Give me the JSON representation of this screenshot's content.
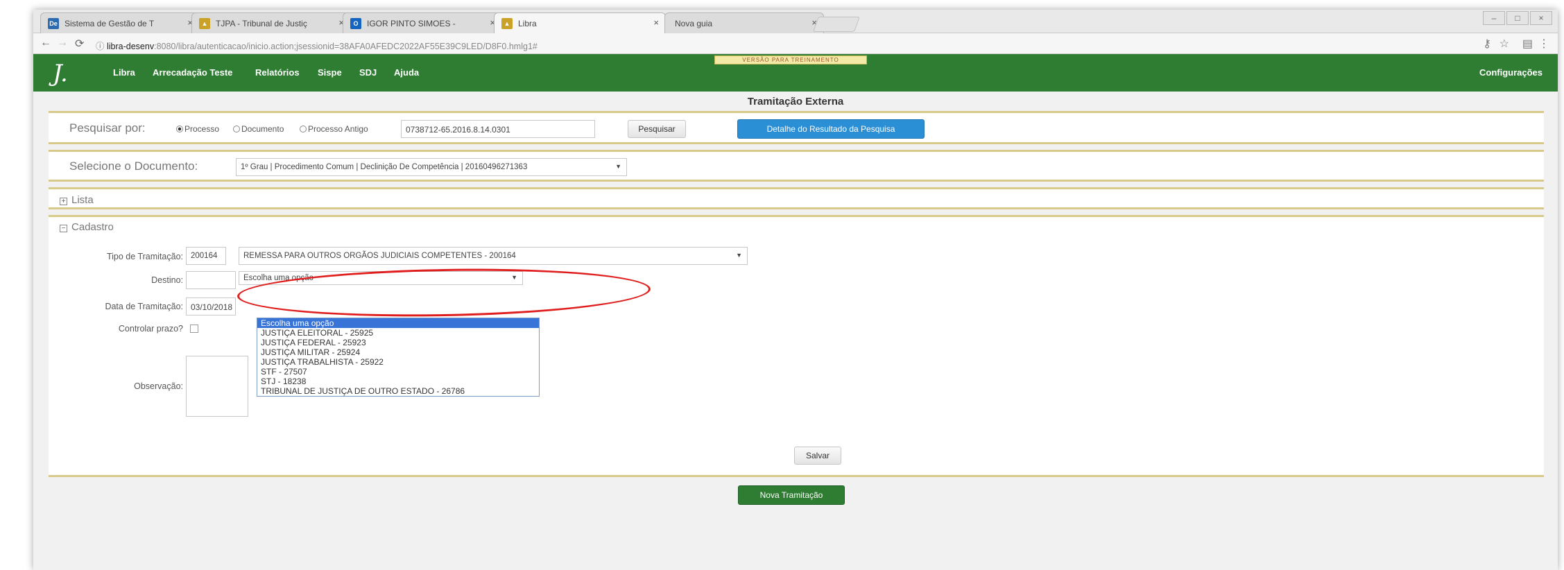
{
  "browser": {
    "tabs": [
      {
        "title": "Sistema de Gestão de T",
        "fav": "De",
        "fav_color": "#2b6cb0"
      },
      {
        "title": "TJPA - Tribunal de Justiç",
        "fav": "▲",
        "fav_color": "#c9a227"
      },
      {
        "title": "IGOR PINTO SIMOES - ",
        "fav": "O",
        "fav_color": "#1565c0"
      },
      {
        "title": "Libra",
        "fav": "▲",
        "fav_color": "#c9a227"
      },
      {
        "title": "Nova guia",
        "fav": "",
        "fav_color": "#dcdcdc"
      }
    ],
    "url_host": "libra-desenv",
    "url_rest": ":8080/libra/autenticacao/inicio.action;jsessionid=38AFA0AFEDC2022AF55E39C9LED/D8F0.hmlg1#"
  },
  "nav": {
    "logo": "J.",
    "items": [
      "Libra",
      "Arrecadação Teste",
      "Relatórios",
      "Sispe",
      "SDJ",
      "Ajuda"
    ],
    "right": "Configurações",
    "badge": "VERSÃO PARA TREINAMENTO"
  },
  "page_title": "Tramitação Externa",
  "search": {
    "label": "Pesquisar por:",
    "options": [
      "Processo",
      "Documento",
      "Processo Antigo"
    ],
    "selected": "Processo",
    "value": "0738712-65.2016.8.14.0301",
    "button": "Pesquisar",
    "detail_button": "Detalhe do Resultado da Pesquisa"
  },
  "document": {
    "label": "Selecione o Documento:",
    "value": "1º Grau | Procedimento Comum | Declinição De Competência | 20160496271363"
  },
  "lista": {
    "label": "Lista",
    "toggle": "+"
  },
  "cadastro": {
    "label": "Cadastro",
    "toggle": "−",
    "tipo_label": "Tipo de Tramitação:",
    "tipo_code": "200164",
    "tipo_value": "REMESSA PARA OUTROS ORGÃOS JUDICIAIS COMPETENTES - 200164",
    "destino_label": "Destino:",
    "destino_value": "Escolha uma opção",
    "data_label": "Data de Tramitação:",
    "data_value": "03/10/2018",
    "prazo_label": "Controlar prazo?",
    "obs_label": "Observação:",
    "save_button": "Salvar"
  },
  "destino_options": [
    "Escolha uma opção",
    "JUSTIÇA ELEITORAL - 25925",
    "JUSTIÇA FEDERAL - 25923",
    "JUSTIÇA MILITAR - 25924",
    "JUSTIÇA TRABALHISTA - 25922",
    "STF - 27507",
    "STJ - 18238",
    "TRIBUNAL DE JUSTIÇA DE OUTRO ESTADO - 26786"
  ],
  "new_button": "Nova Tramitação",
  "colors": {
    "nav_green": "#2e7d32",
    "accent_blue": "#2b8fd6",
    "highlight": "#e01e1e",
    "panel_border": "#d6c98a"
  }
}
